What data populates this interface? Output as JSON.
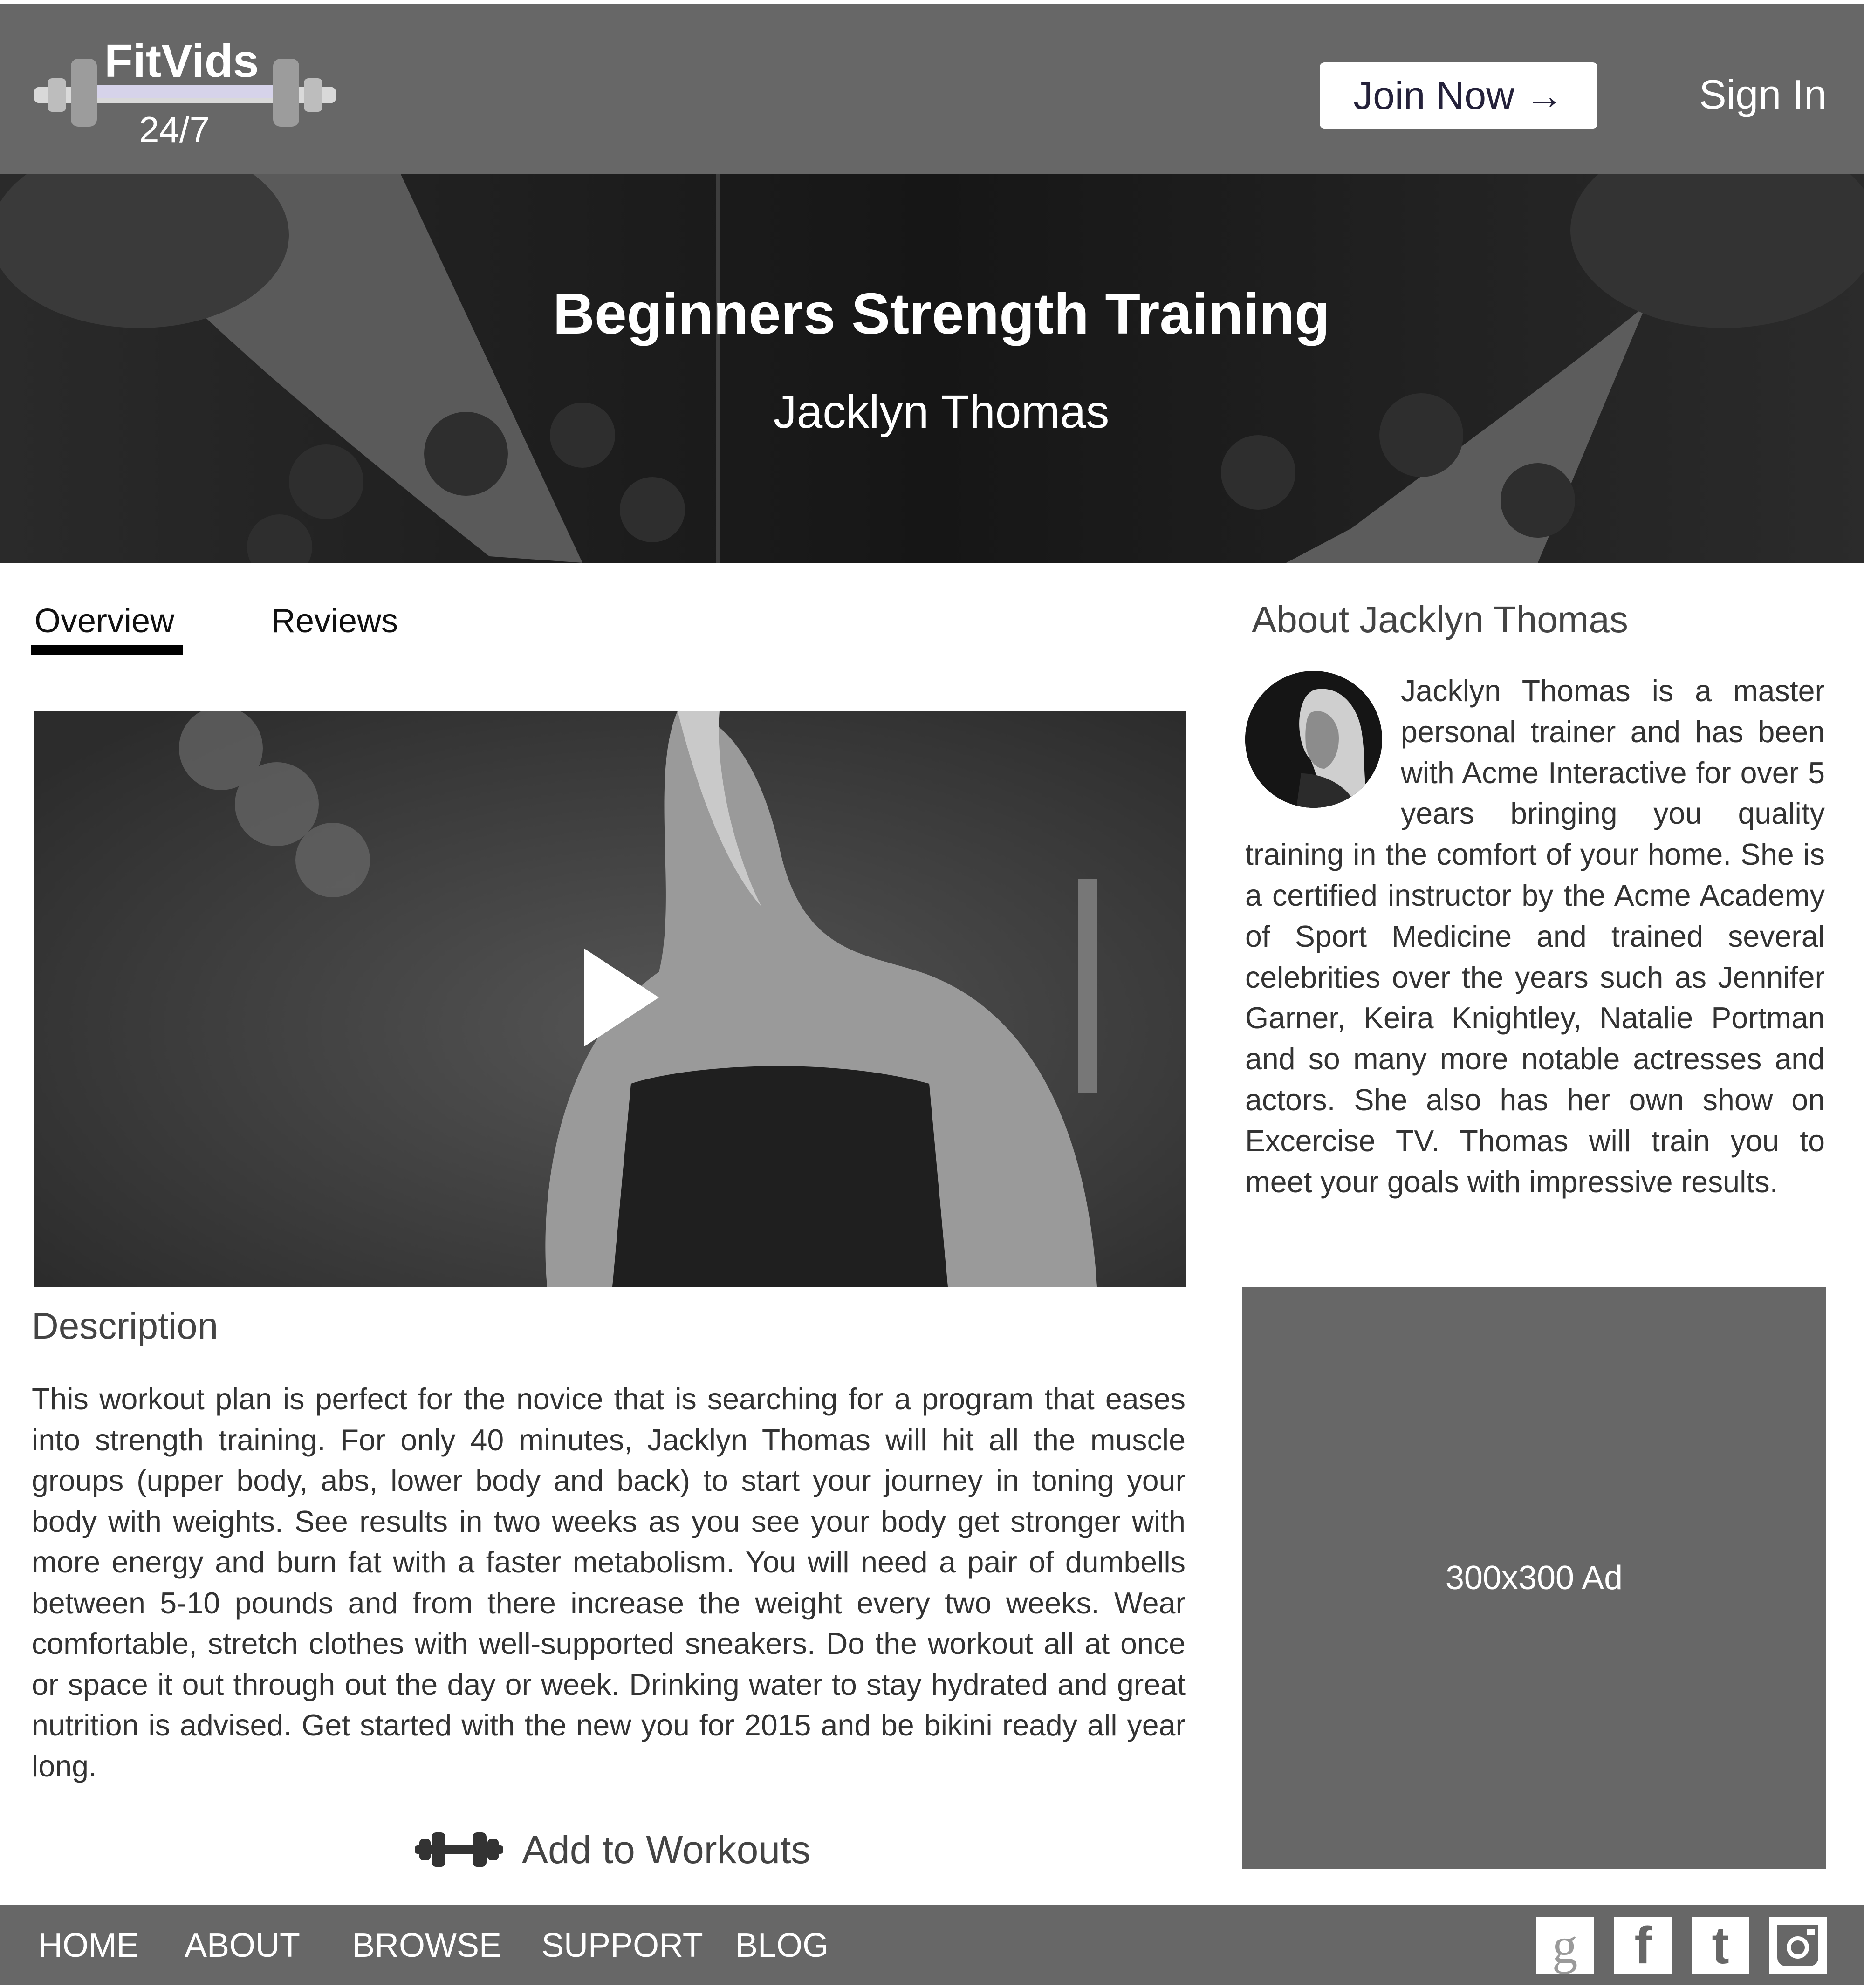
{
  "header": {
    "logo_name": "FitVids",
    "logo_sub": "24/7",
    "join_label": "Join Now",
    "join_arrow": "→",
    "signin_label": "Sign In"
  },
  "hero": {
    "title": "Beginners Strength Training",
    "trainer": "Jacklyn Thomas"
  },
  "tabs": [
    {
      "label": "Overview",
      "active": true
    },
    {
      "label": "Reviews",
      "active": false
    }
  ],
  "description": {
    "heading": "Description",
    "body": "This workout plan is perfect for the novice that is searching for a program that eases into strength training. For only 40 minutes, Jacklyn Thomas will hit all the muscle groups (upper body, abs, lower body and back) to start your journey in toning your body with weights. See results in two weeks as you see your body get stronger with more energy and burn fat with a faster metabolism. You will need a pair of dumbells between 5-10 pounds and from there increase the weight every two weeks. Wear comfortable, stretch clothes with well-supported sneakers. Do the workout all at once or space it out through out the day or week. Drinking water to stay hydrated and great nutrition is advised. Get started with the new you for 2015 and be bikini ready all year long.",
    "add_label": "Add to Workouts"
  },
  "about": {
    "heading": "About Jacklyn Thomas",
    "body": "Jacklyn Thomas is a master personal trainer and has been with Acme Interactive for over 5 years bringing you quality training in the comfort of your home. She is a certified instructor by the Acme Academy of Sport Medicine and trained several celebrities over the years such as Jennifer Garner, Keira Knightley, Natalie Portman and so many more notable actresses and actors. She also has her own show on Excercise TV. Thomas will train you to meet your goals with impressive results."
  },
  "ad": {
    "label": "300x300 Ad"
  },
  "footer": {
    "nav": [
      "HOME",
      "ABOUT",
      "BROWSE",
      "SUPPORT",
      "BLOG"
    ],
    "social_icons": [
      "google-icon",
      "facebook-icon",
      "twitter-icon",
      "instagram-icon"
    ],
    "social_glyphs": [
      "g",
      "f",
      "t",
      ""
    ]
  },
  "colors": {
    "header_bg": "#676767",
    "button_text": "#24213a",
    "logo_bar": "#d6d3ea"
  }
}
